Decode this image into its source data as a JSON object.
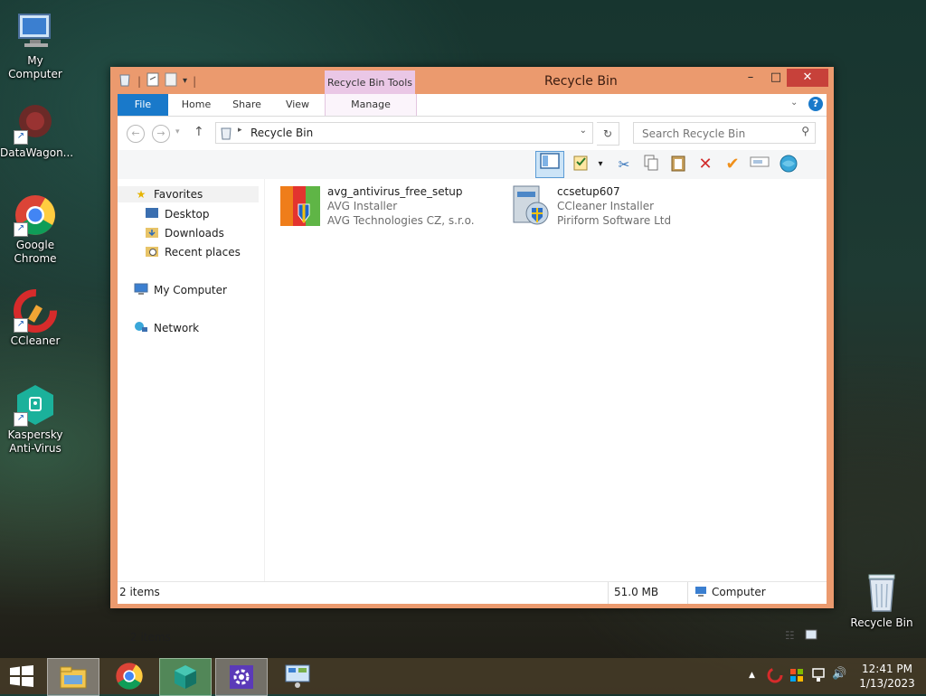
{
  "desktop": {
    "icons": [
      {
        "label": "My Computer"
      },
      {
        "label": "DataWagon..."
      },
      {
        "label": "Google Chrome"
      },
      {
        "label": "CCleaner"
      },
      {
        "label": "Kaspersky Anti-Virus"
      },
      {
        "label": "Recycle Bin"
      }
    ]
  },
  "window": {
    "title": "Recycle Bin",
    "contextual_tab_group": "Recycle Bin Tools",
    "controls": {
      "minimize": "–",
      "maximize": "□",
      "close": "✕"
    },
    "ribbon_tabs": [
      "File",
      "Home",
      "Share",
      "View",
      "Manage"
    ],
    "address": {
      "path": "Recycle Bin"
    },
    "search": {
      "placeholder": "Search Recycle Bin"
    },
    "navigation": {
      "favorites": "Favorites",
      "favorites_items": [
        "Desktop",
        "Downloads",
        "Recent places"
      ],
      "my_computer": "My Computer",
      "network": "Network"
    },
    "files": [
      {
        "name": "avg_antivirus_free_setup",
        "description": "AVG Installer",
        "company": "AVG Technologies CZ, s.r.o."
      },
      {
        "name": "ccsetup607",
        "description": "CCleaner Installer",
        "company": "Piriform Software Ltd"
      }
    ],
    "items_count_pane": "2 items",
    "status": {
      "items": "2 items",
      "size": "51.0 MB",
      "location": "Computer"
    }
  },
  "taskbar": {
    "clock_time": "12:41 PM",
    "clock_date": "1/13/2023",
    "tray_expand": "▲"
  },
  "colors": {
    "window_frame": "#eb9a6e",
    "file_tab": "#1979ca",
    "context_tab": "#eac7e6",
    "close_button": "#c7413a"
  }
}
